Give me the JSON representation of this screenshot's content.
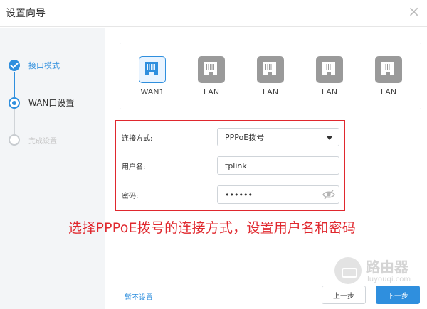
{
  "window": {
    "title": "设置向导",
    "close_glyph": "×"
  },
  "steps": [
    {
      "label": "接口模式",
      "state": "done"
    },
    {
      "label": "WAN口设置",
      "state": "current"
    },
    {
      "label": "完成设置",
      "state": "todo"
    }
  ],
  "ports": [
    {
      "label": "WAN1",
      "active": true
    },
    {
      "label": "LAN",
      "active": false
    },
    {
      "label": "LAN",
      "active": false
    },
    {
      "label": "LAN",
      "active": false
    },
    {
      "label": "LAN",
      "active": false
    }
  ],
  "form": {
    "connection_label": "连接方式:",
    "connection_value": "PPPoE拨号",
    "username_label": "用户名:",
    "username_value": "tplink",
    "password_label": "密码:",
    "password_masked": "••••••"
  },
  "annotation": "选择PPPoE拨号的连接方式，设置用户名和密码",
  "footer": {
    "skip_label": "暂不设置",
    "prev_label": "上一步",
    "next_label": "下一步"
  },
  "watermark": {
    "text": "路由器",
    "url": "luyouqi.com"
  },
  "colors": {
    "accent": "#2f8fde",
    "highlight": "#e0282e",
    "sidebar_bg": "#f3f5f7"
  },
  "icons": {
    "close": "close-icon",
    "check": "check-icon",
    "port": "ethernet-port-icon",
    "dropdown": "chevron-down-icon",
    "password_toggle": "eye-slash-icon"
  }
}
